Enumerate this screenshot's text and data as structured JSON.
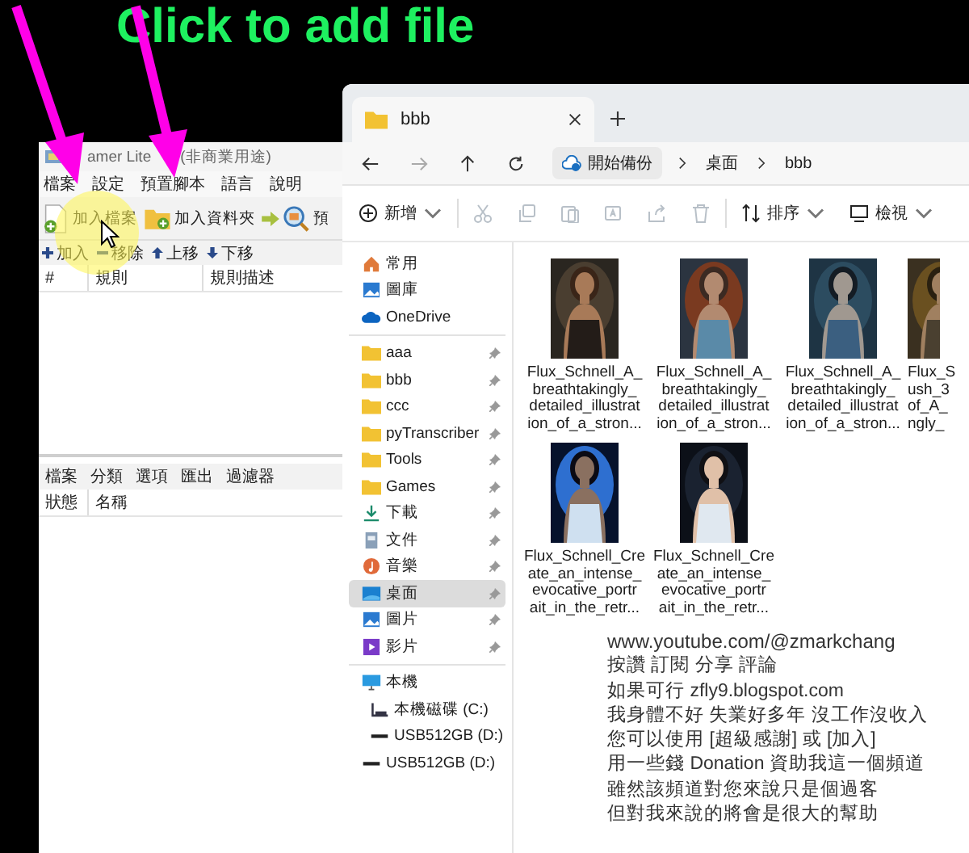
{
  "banner": {
    "text": "Click to add file"
  },
  "renamer": {
    "title_parts": [
      "amer Lite",
      "(非商業用途)"
    ],
    "menu": [
      "檔案",
      "設定",
      "預置腳本",
      "語言",
      "說明"
    ],
    "toolbar": [
      {
        "kind": "file",
        "label": "加入檔案"
      },
      {
        "kind": "folder",
        "label": "加入資料夾"
      },
      {
        "kind": "next"
      },
      {
        "kind": "preview",
        "label": "預"
      }
    ],
    "rule_actions": [
      {
        "kind": "add",
        "label": "加入"
      },
      {
        "kind": "remove",
        "label": "移除"
      },
      {
        "kind": "up",
        "label": "上移"
      },
      {
        "kind": "down",
        "label": "下移"
      }
    ],
    "rule_columns": [
      "#",
      "規則",
      "規則描述"
    ],
    "bottom_tabs": [
      "檔案",
      "分類",
      "選項",
      "匯出",
      "過濾器"
    ],
    "file_columns": [
      "狀態",
      "名稱"
    ]
  },
  "explorer": {
    "tab": {
      "title": "bbb"
    },
    "breadcrumb": [
      "開始備份",
      "桌面",
      "bbb"
    ],
    "toolbar": [
      {
        "kind": "new",
        "label": "新增",
        "disabled": false
      },
      {
        "kind": "cut",
        "disabled": true
      },
      {
        "kind": "copy",
        "disabled": true
      },
      {
        "kind": "paste",
        "disabled": true
      },
      {
        "kind": "rename",
        "disabled": true
      },
      {
        "kind": "share",
        "disabled": true
      },
      {
        "kind": "delete",
        "disabled": true
      },
      {
        "kind": "sort",
        "label": "排序",
        "disabled": false
      },
      {
        "kind": "view",
        "label": "檢視",
        "disabled": false
      }
    ],
    "quick": [
      {
        "kind": "home",
        "label": "常用"
      },
      {
        "kind": "gallery",
        "label": "圖庫"
      },
      {
        "kind": "cloud",
        "label": "OneDrive"
      }
    ],
    "pinned": [
      {
        "kind": "folder",
        "label": "aaa",
        "selected": false
      },
      {
        "kind": "folder",
        "label": "bbb",
        "selected": false
      },
      {
        "kind": "folder",
        "label": "ccc",
        "selected": false
      },
      {
        "kind": "folder",
        "label": "pyTranscriber",
        "selected": false
      },
      {
        "kind": "folder",
        "label": "Tools",
        "selected": false
      },
      {
        "kind": "folder",
        "label": "Games",
        "selected": false
      },
      {
        "kind": "download",
        "label": "下載",
        "selected": false
      },
      {
        "kind": "document",
        "label": "文件",
        "selected": false
      },
      {
        "kind": "music",
        "label": "音樂",
        "selected": false
      },
      {
        "kind": "desktop",
        "label": "桌面",
        "selected": true
      },
      {
        "kind": "pictures",
        "label": "圖片",
        "selected": false
      },
      {
        "kind": "video",
        "label": "影片",
        "selected": false
      }
    ],
    "drives": [
      {
        "kind": "pc",
        "label": "本機",
        "children": [
          {
            "kind": "disk",
            "label": "本機磁碟 (C:)"
          },
          {
            "kind": "usb",
            "label": "USB512GB (D:)"
          }
        ]
      },
      {
        "kind": "usb",
        "label": "USB512GB (D:)"
      }
    ],
    "files": [
      {
        "kind": "picture",
        "lines": [
          "Flux_Schnell_A_",
          "breathtakingly_",
          "detailed_illustrat",
          "ion_of_a_stron..."
        ]
      },
      {
        "kind": "picture",
        "lines": [
          "Flux_Schnell_A_",
          "breathtakingly_",
          "detailed_illustrat",
          "ion_of_a_stron..."
        ]
      },
      {
        "kind": "picture",
        "lines": [
          "Flux_Schnell_A_",
          "breathtakingly_",
          "detailed_illustrat",
          "ion_of_a_stron..."
        ]
      },
      {
        "kind": "picture",
        "lines": [
          "Flux_S",
          "ush_3",
          "of_A_",
          "ngly_"
        ]
      },
      {
        "kind": "picture",
        "lines": [
          "Flux_Schnell_Cre",
          "ate_an_intense_",
          "evocative_portr",
          "ait_in_the_retr..."
        ]
      },
      {
        "kind": "picture",
        "lines": [
          "Flux_Schnell_Cre",
          "ate_an_intense_",
          "evocative_portr",
          "ait_in_the_retr..."
        ]
      }
    ]
  },
  "caption": [
    "www.youtube.com/@zmarkchang",
    "按讚 訂閱 分享 評論",
    "如果可行 zfly9.blogspot.com",
    "我身體不好 失業好多年 沒工作沒收入",
    "您可以使用 [超級感謝] 或 [加入]",
    "用一些錢 Donation 資助我這一個頻道",
    "雖然該頻道對您來說只是個過客",
    "但對我來說的將會是很大的幫助"
  ]
}
